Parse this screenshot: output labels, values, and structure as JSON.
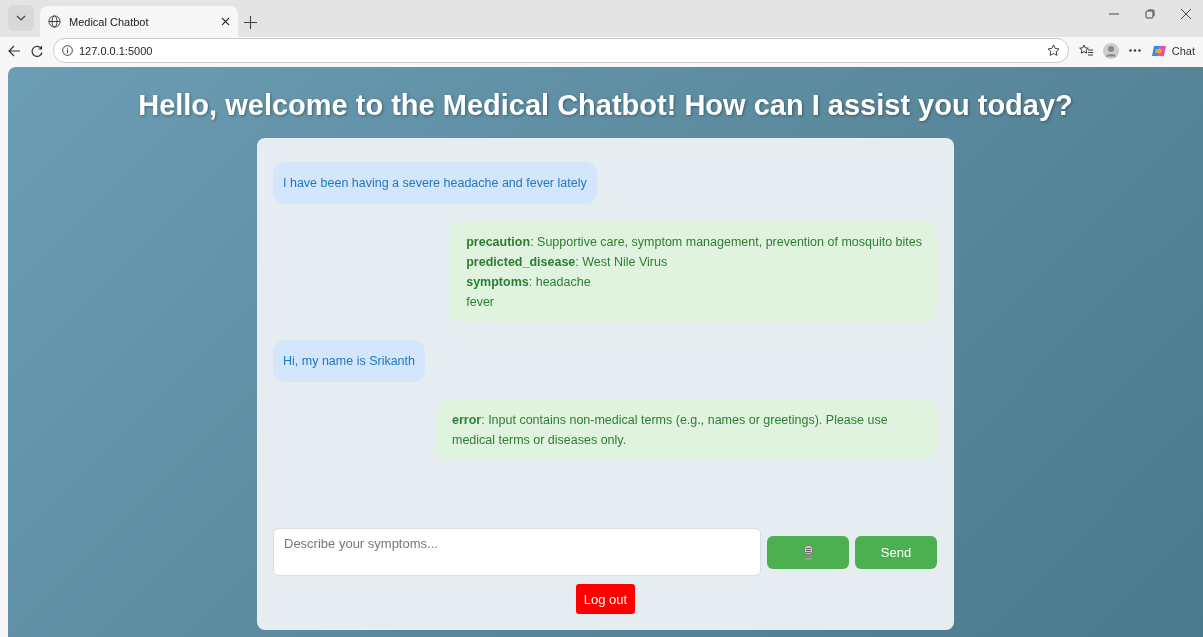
{
  "browser": {
    "tab": {
      "title": "Medical Chatbot",
      "selected": true
    },
    "url": "127.0.0.1:5000",
    "copilot_label": "Chat"
  },
  "page": {
    "heading": "Hello, welcome to the Medical Chatbot! How can I assist you today?",
    "messages": [
      {
        "kind": "user",
        "lines": [
          "I have been having a severe headache and fever lately"
        ]
      },
      {
        "kind": "bot",
        "lines": [
          "**precaution**: Supportive care, symptom management, prevention of mosquito bites",
          "**predicted_disease**: West Nile Virus",
          "**symptoms**: headache",
          "fever"
        ]
      },
      {
        "kind": "user",
        "lines": [
          "Hi, my name is Srikanth"
        ]
      },
      {
        "kind": "bot",
        "lines": [
          "**error**: Input contains non-medical terms (e.g., names or greetings). Please use medical terms or diseases only."
        ]
      }
    ],
    "input": {
      "placeholder": "Describe your symptoms..."
    },
    "send_label": "Send",
    "logout_label": "Log out"
  }
}
